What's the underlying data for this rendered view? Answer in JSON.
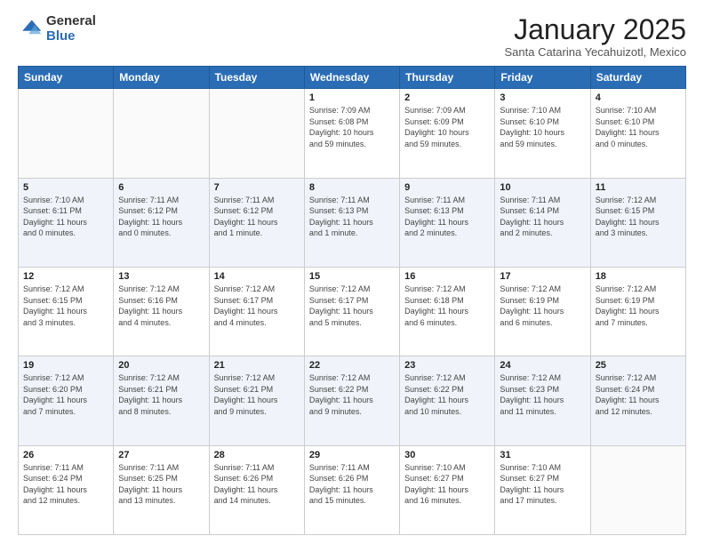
{
  "header": {
    "logo_general": "General",
    "logo_blue": "Blue",
    "title": "January 2025",
    "location": "Santa Catarina Yecahuizotl, Mexico"
  },
  "days_of_week": [
    "Sunday",
    "Monday",
    "Tuesday",
    "Wednesday",
    "Thursday",
    "Friday",
    "Saturday"
  ],
  "weeks": [
    [
      {
        "day": "",
        "info": ""
      },
      {
        "day": "",
        "info": ""
      },
      {
        "day": "",
        "info": ""
      },
      {
        "day": "1",
        "info": "Sunrise: 7:09 AM\nSunset: 6:08 PM\nDaylight: 10 hours\nand 59 minutes."
      },
      {
        "day": "2",
        "info": "Sunrise: 7:09 AM\nSunset: 6:09 PM\nDaylight: 10 hours\nand 59 minutes."
      },
      {
        "day": "3",
        "info": "Sunrise: 7:10 AM\nSunset: 6:10 PM\nDaylight: 10 hours\nand 59 minutes."
      },
      {
        "day": "4",
        "info": "Sunrise: 7:10 AM\nSunset: 6:10 PM\nDaylight: 11 hours\nand 0 minutes."
      }
    ],
    [
      {
        "day": "5",
        "info": "Sunrise: 7:10 AM\nSunset: 6:11 PM\nDaylight: 11 hours\nand 0 minutes."
      },
      {
        "day": "6",
        "info": "Sunrise: 7:11 AM\nSunset: 6:12 PM\nDaylight: 11 hours\nand 0 minutes."
      },
      {
        "day": "7",
        "info": "Sunrise: 7:11 AM\nSunset: 6:12 PM\nDaylight: 11 hours\nand 1 minute."
      },
      {
        "day": "8",
        "info": "Sunrise: 7:11 AM\nSunset: 6:13 PM\nDaylight: 11 hours\nand 1 minute."
      },
      {
        "day": "9",
        "info": "Sunrise: 7:11 AM\nSunset: 6:13 PM\nDaylight: 11 hours\nand 2 minutes."
      },
      {
        "day": "10",
        "info": "Sunrise: 7:11 AM\nSunset: 6:14 PM\nDaylight: 11 hours\nand 2 minutes."
      },
      {
        "day": "11",
        "info": "Sunrise: 7:12 AM\nSunset: 6:15 PM\nDaylight: 11 hours\nand 3 minutes."
      }
    ],
    [
      {
        "day": "12",
        "info": "Sunrise: 7:12 AM\nSunset: 6:15 PM\nDaylight: 11 hours\nand 3 minutes."
      },
      {
        "day": "13",
        "info": "Sunrise: 7:12 AM\nSunset: 6:16 PM\nDaylight: 11 hours\nand 4 minutes."
      },
      {
        "day": "14",
        "info": "Sunrise: 7:12 AM\nSunset: 6:17 PM\nDaylight: 11 hours\nand 4 minutes."
      },
      {
        "day": "15",
        "info": "Sunrise: 7:12 AM\nSunset: 6:17 PM\nDaylight: 11 hours\nand 5 minutes."
      },
      {
        "day": "16",
        "info": "Sunrise: 7:12 AM\nSunset: 6:18 PM\nDaylight: 11 hours\nand 6 minutes."
      },
      {
        "day": "17",
        "info": "Sunrise: 7:12 AM\nSunset: 6:19 PM\nDaylight: 11 hours\nand 6 minutes."
      },
      {
        "day": "18",
        "info": "Sunrise: 7:12 AM\nSunset: 6:19 PM\nDaylight: 11 hours\nand 7 minutes."
      }
    ],
    [
      {
        "day": "19",
        "info": "Sunrise: 7:12 AM\nSunset: 6:20 PM\nDaylight: 11 hours\nand 7 minutes."
      },
      {
        "day": "20",
        "info": "Sunrise: 7:12 AM\nSunset: 6:21 PM\nDaylight: 11 hours\nand 8 minutes."
      },
      {
        "day": "21",
        "info": "Sunrise: 7:12 AM\nSunset: 6:21 PM\nDaylight: 11 hours\nand 9 minutes."
      },
      {
        "day": "22",
        "info": "Sunrise: 7:12 AM\nSunset: 6:22 PM\nDaylight: 11 hours\nand 9 minutes."
      },
      {
        "day": "23",
        "info": "Sunrise: 7:12 AM\nSunset: 6:22 PM\nDaylight: 11 hours\nand 10 minutes."
      },
      {
        "day": "24",
        "info": "Sunrise: 7:12 AM\nSunset: 6:23 PM\nDaylight: 11 hours\nand 11 minutes."
      },
      {
        "day": "25",
        "info": "Sunrise: 7:12 AM\nSunset: 6:24 PM\nDaylight: 11 hours\nand 12 minutes."
      }
    ],
    [
      {
        "day": "26",
        "info": "Sunrise: 7:11 AM\nSunset: 6:24 PM\nDaylight: 11 hours\nand 12 minutes."
      },
      {
        "day": "27",
        "info": "Sunrise: 7:11 AM\nSunset: 6:25 PM\nDaylight: 11 hours\nand 13 minutes."
      },
      {
        "day": "28",
        "info": "Sunrise: 7:11 AM\nSunset: 6:26 PM\nDaylight: 11 hours\nand 14 minutes."
      },
      {
        "day": "29",
        "info": "Sunrise: 7:11 AM\nSunset: 6:26 PM\nDaylight: 11 hours\nand 15 minutes."
      },
      {
        "day": "30",
        "info": "Sunrise: 7:10 AM\nSunset: 6:27 PM\nDaylight: 11 hours\nand 16 minutes."
      },
      {
        "day": "31",
        "info": "Sunrise: 7:10 AM\nSunset: 6:27 PM\nDaylight: 11 hours\nand 17 minutes."
      },
      {
        "day": "",
        "info": ""
      }
    ]
  ]
}
